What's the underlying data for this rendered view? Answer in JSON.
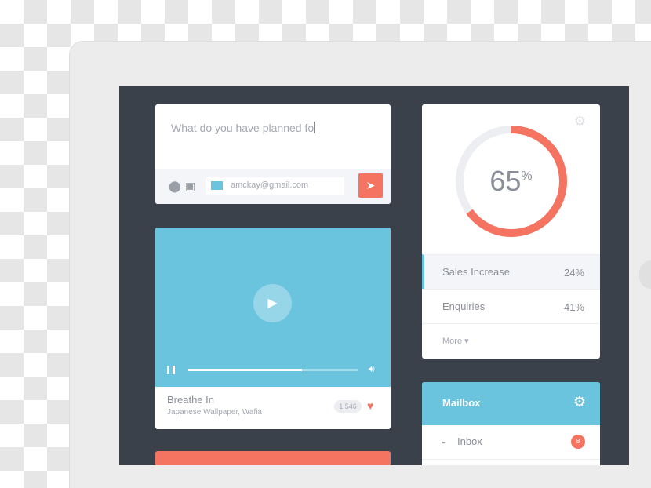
{
  "compose": {
    "text": "What do you have planned fo",
    "email": "amckay@gmail.com",
    "icons": [
      "map-pin-icon",
      "camera-icon",
      "envelope-icon",
      "send-icon"
    ]
  },
  "video": {
    "title": "Breathe In",
    "subtitle": "Japanese Wallpaper, Wafia",
    "likes": "1,546",
    "progress": 0.67
  },
  "stats": {
    "percent": "65",
    "percent_sign": "%",
    "progress": 65,
    "rows": [
      {
        "label": "Sales Increase",
        "value": "24%"
      },
      {
        "label": "Enquiries",
        "value": "41%"
      }
    ],
    "more": "More ▾"
  },
  "mailbox": {
    "title": "Mailbox",
    "inbox_label": "Inbox",
    "inbox_count": "8"
  },
  "colors": {
    "accent": "#6bc4de",
    "coral": "#f47361",
    "dark": "#3b414b"
  }
}
